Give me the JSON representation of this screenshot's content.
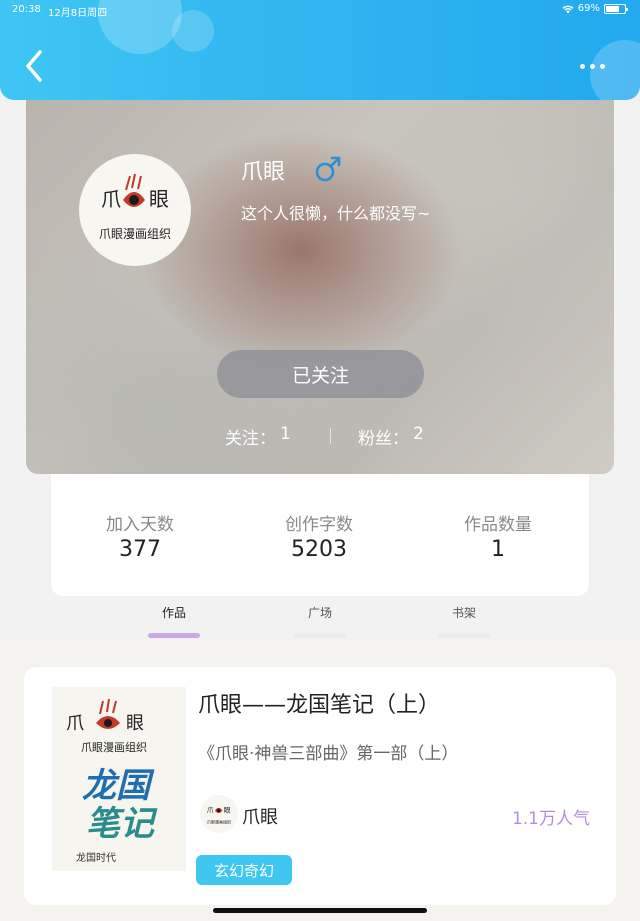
{
  "status_bar": {
    "time": "20:38",
    "date": "12月8日周四",
    "battery": "69%"
  },
  "header": {
    "back_icon": "chevron-left-icon",
    "more_icon": "ellipsis-icon",
    "accent_color": "#30b6ef"
  },
  "profile": {
    "nickname": "爪眼",
    "gender_icon": "male-symbol-icon",
    "gender_color": "#2a8fd8",
    "bio": "这个人很懒，什么都没写~",
    "avatar_text_top_left": "爪",
    "avatar_text_top_right": "眼",
    "avatar_text_bottom": "爪眼漫画组织",
    "follow_button": "已关注",
    "following_label": "关注：",
    "following_count": "1",
    "fans_label": "粉丝：",
    "fans_count": "2"
  },
  "stats": [
    {
      "label": "加入天数",
      "value": "377"
    },
    {
      "label": "创作字数",
      "value": "5203"
    },
    {
      "label": "作品数量",
      "value": "1"
    }
  ],
  "tabs": [
    {
      "label": "作品",
      "active": true
    },
    {
      "label": "广场",
      "active": false
    },
    {
      "label": "书架",
      "active": false
    }
  ],
  "works": [
    {
      "title": "爪眼——龙国笔记（上）",
      "subtitle": "《爪眼·神兽三部曲》第一部（上）",
      "author": "爪眼",
      "popularity": "1.1万人气",
      "genre": "玄幻奇幻",
      "cover_text_top_left": "爪",
      "cover_text_top_right": "眼",
      "cover_text_org": "爪眼漫画组织",
      "cover_title_line1": "龙国",
      "cover_title_line2": "笔记",
      "cover_footer": "龙国时代"
    }
  ]
}
